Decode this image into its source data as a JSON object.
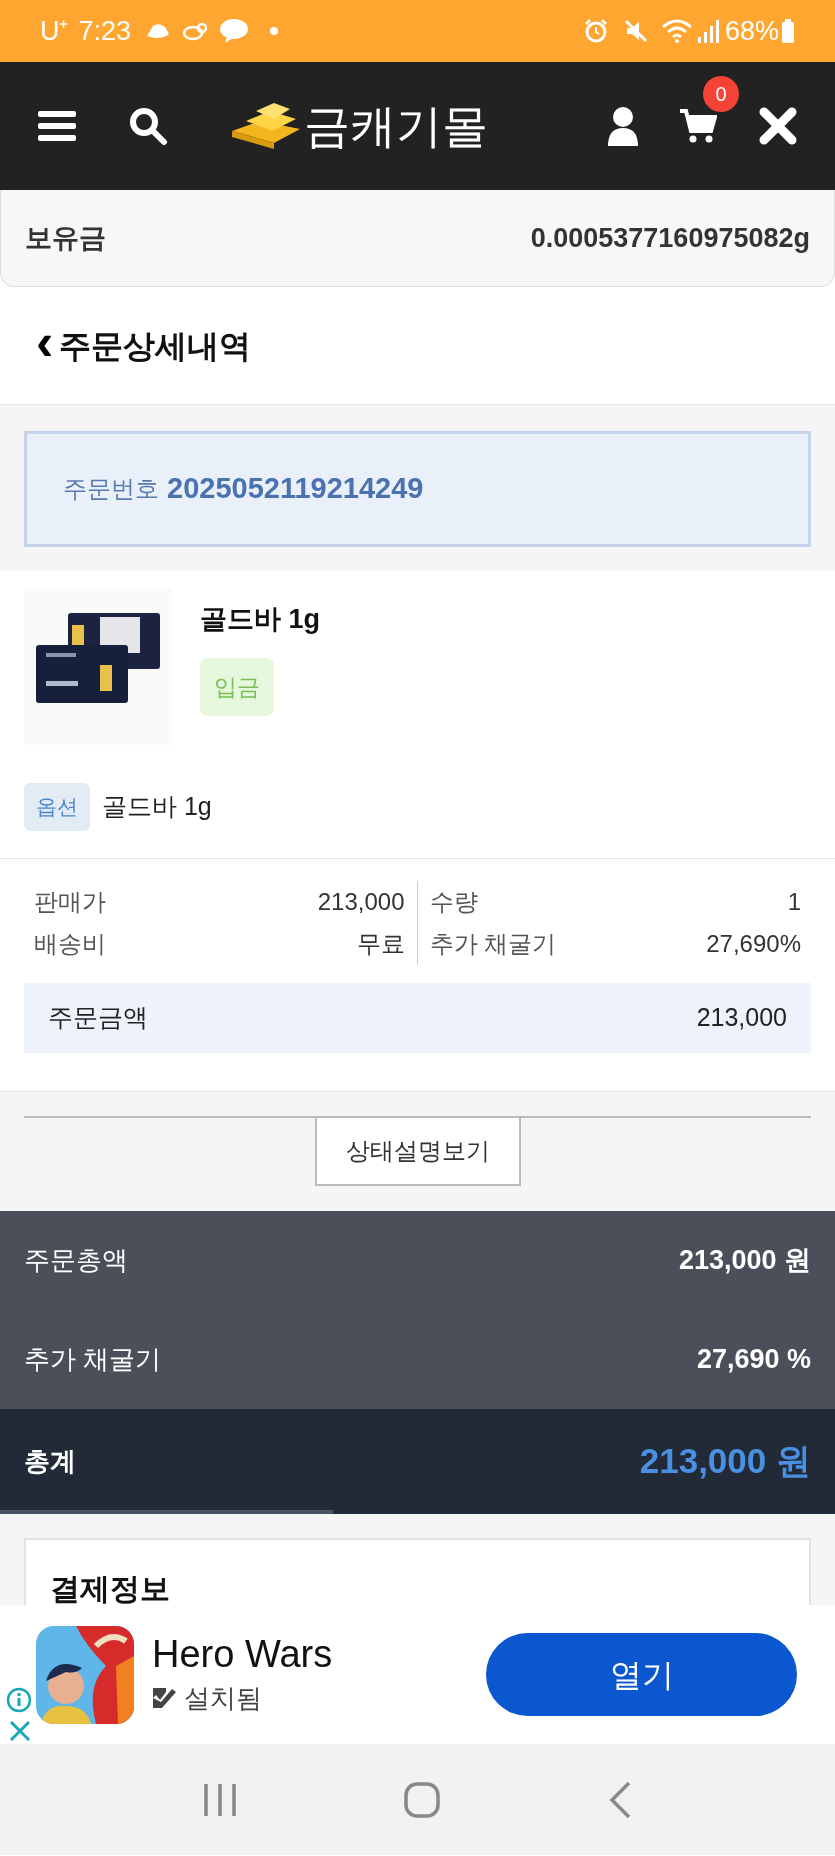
{
  "status_bar": {
    "carrier": "U⁺",
    "time": "7:23",
    "battery": "68%"
  },
  "header": {
    "logo": "금캐기몰",
    "cart_count": "0"
  },
  "holdings": {
    "label": "보유금",
    "value": "0.0005377160975082g"
  },
  "page_title": {
    "back": "‹",
    "title": "주문상세내역"
  },
  "order": {
    "label": "주문번호",
    "number": "2025052119214249"
  },
  "product": {
    "name": "골드바 1g",
    "status": "입금",
    "option_label": "옵션",
    "option_value": "골드바 1g"
  },
  "details": [
    {
      "label": "판매가",
      "value": "213,000"
    },
    {
      "label": "수량",
      "value": "1"
    },
    {
      "label": "배송비",
      "value": "무료"
    },
    {
      "label": "추가 채굴기",
      "value": "27,690%"
    }
  ],
  "order_amount": {
    "label": "주문금액",
    "value": "213,000"
  },
  "status_button": "상태설명보기",
  "summary": [
    {
      "label": "주문총액",
      "value": "213,000 원"
    },
    {
      "label": "추가 채굴기",
      "value": "27,690 %"
    }
  ],
  "total": {
    "label": "총계",
    "value": "213,000 원"
  },
  "payment": {
    "title": "결제정보"
  },
  "ad": {
    "app_name": "Hero Wars",
    "installed": "설치됨",
    "open_button": "열기"
  }
}
